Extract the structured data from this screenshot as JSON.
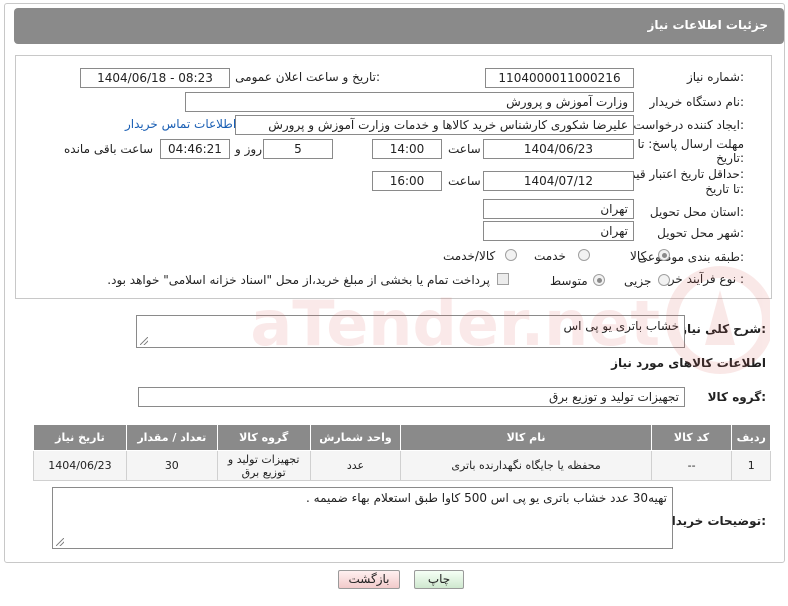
{
  "header": {
    "title": "جزئیات اطلاعات نیاز"
  },
  "form": {
    "need_number_label": "شماره نیاز:",
    "need_number": "1104000011000216",
    "announce_label": "تاریخ و ساعت اعلان عمومی:",
    "announce_value": "1404/06/18 - 08:23",
    "buyer_org_label": "نام دستگاه خریدار:",
    "buyer_org": "وزارت آموزش و پرورش",
    "creator_label": "ایجاد کننده درخواست:",
    "creator": "علیرضا شکوری کارشناس خرید کالاها و خدمات وزارت آموزش و پرورش",
    "contact_link": "اطلاعات تماس خریدار",
    "reply_deadline_label_1": "مهلت ارسال پاسخ: تا",
    "reply_deadline_label_2": "تاریخ:",
    "reply_date": "1404/06/23",
    "time_label": "ساعت",
    "reply_time": "14:00",
    "days_value": "5",
    "days_label": "روز و",
    "remaining_time": "04:46:21",
    "remaining_label": "ساعت باقی مانده",
    "price_validity_label_1": "حداقل تاریخ اعتبار قیمت:",
    "price_validity_label_2": "تا تاریخ:",
    "price_date": "1404/07/12",
    "price_time": "16:00",
    "province_label": "استان محل تحویل:",
    "province": "تهران",
    "city_label": "شهر محل تحویل:",
    "city": "تهران",
    "category_label": "طبقه بندی موضوعی:",
    "category_options": [
      "کالا",
      "خدمت",
      "کالا/خدمت"
    ],
    "category_selected": "کالا",
    "process_label": "نوع فرآیند خرید :",
    "process_options": [
      "جزیی",
      "متوسط"
    ],
    "process_selected": "متوسط",
    "treasury_note": "پرداخت تمام یا بخشی از مبلغ خرید،از محل \"اسناد خزانه اسلامی\" خواهد بود."
  },
  "summary": {
    "label": "شرح کلی نیاز:",
    "value": "خشاب باتری یو پی اس"
  },
  "goods_section": {
    "heading": "اطلاعات کالاهای مورد نیاز",
    "group_label": "گروه کالا:",
    "group_value": "تجهیزات تولید و توزیع برق"
  },
  "table": {
    "headers": [
      "ردیف",
      "کد کالا",
      "نام کالا",
      "واحد شمارش",
      "گروه کالا",
      "تعداد / مقدار",
      "تاریخ نیاز"
    ],
    "rows": [
      [
        "1",
        "--",
        "محفظه یا جایگاه نگهدارنده باتری",
        "عدد",
        "تجهیزات تولید و توزیع برق",
        "30",
        "1404/06/23"
      ]
    ]
  },
  "buyer_notes": {
    "label": "توضیحات خریدار:",
    "value": "تهیه30 عدد خشاب باتری یو پی اس 500 کاوا طبق استعلام بهاء ضمیمه ."
  },
  "buttons": {
    "print": "چاپ",
    "back": "بازگشت"
  },
  "watermark": {
    "text": "AriaTender.net"
  },
  "colors": {
    "header_bg": "#8a8a8a",
    "link": "#1a5fb4",
    "watermark": "#d9534f"
  }
}
